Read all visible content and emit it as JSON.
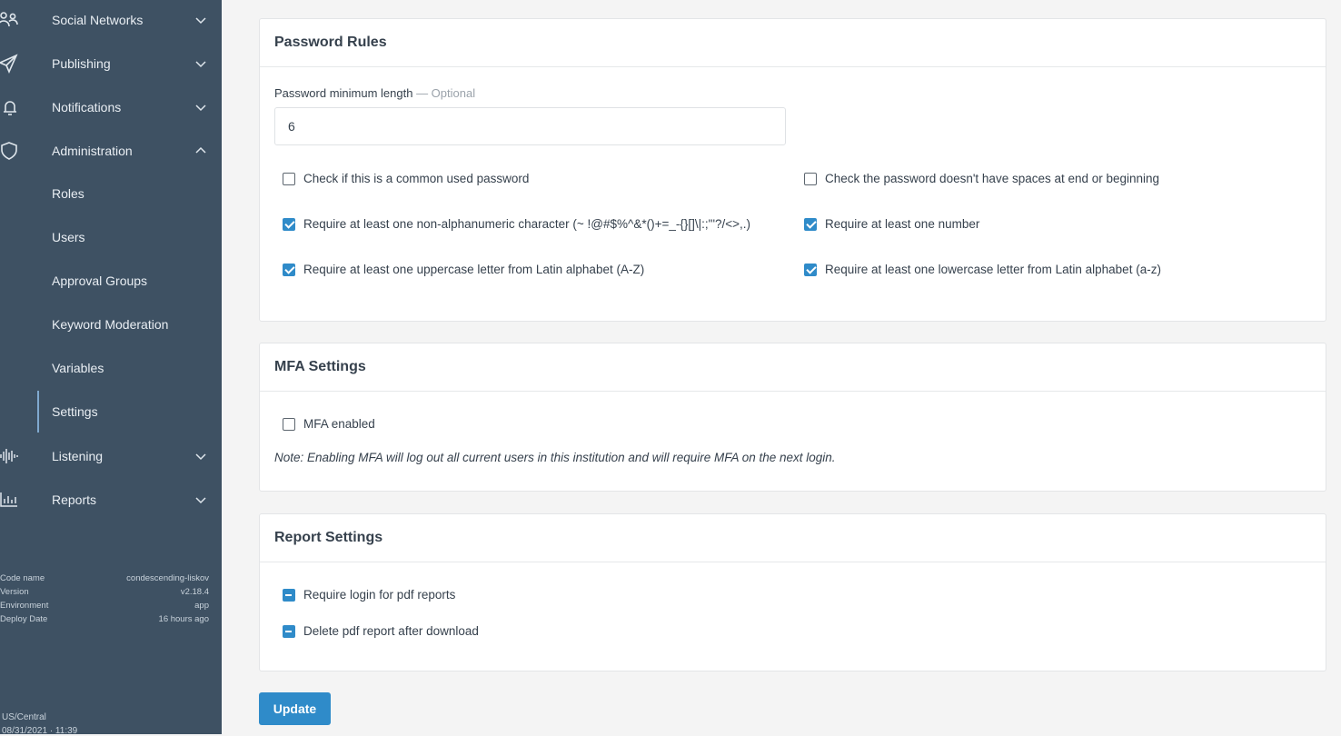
{
  "sidebar": {
    "items": [
      {
        "label": "Social Networks",
        "icon": "users-icon"
      },
      {
        "label": "Publishing",
        "icon": "paper-plane-icon"
      },
      {
        "label": "Notifications",
        "icon": "bell-icon"
      },
      {
        "label": "Administration",
        "icon": "shield-icon"
      },
      {
        "label": "Listening",
        "icon": "waveform-icon"
      },
      {
        "label": "Reports",
        "icon": "bar-chart-icon"
      }
    ],
    "admin_subitems": [
      "Roles",
      "Users",
      "Approval Groups",
      "Keyword Moderation",
      "Variables",
      "Settings"
    ],
    "active_subitem": "Settings",
    "meta": {
      "code_name_label": "Code name",
      "code_name": "condescending-liskov",
      "version_label": "Version",
      "version": "v2.18.4",
      "environment_label": "Environment",
      "environment": "app",
      "deploy_date_label": "Deploy Date",
      "deploy_date": "16 hours ago"
    },
    "timezone": "US/Central",
    "datetime": "08/31/2021 · 11:39"
  },
  "password_rules": {
    "title": "Password Rules",
    "min_length_label": "Password minimum length",
    "min_length_optional": " — Optional",
    "min_length_value": "6",
    "rules": [
      {
        "label": "Check if this is a common used password",
        "checked": false
      },
      {
        "label": "Check the password doesn't have spaces at end or beginning",
        "checked": false
      },
      {
        "label": "Require at least one non-alphanumeric character (~ !@#$%^&*()+=_-{}[]\\|:;\"'?/<>,.)",
        "checked": true
      },
      {
        "label": "Require at least one number",
        "checked": true
      },
      {
        "label": "Require at least one uppercase letter from Latin alphabet (A-Z)",
        "checked": true
      },
      {
        "label": "Require at least one lowercase letter from Latin alphabet (a-z)",
        "checked": true
      }
    ]
  },
  "mfa_settings": {
    "title": "MFA Settings",
    "mfa_label": "MFA enabled",
    "mfa_checked": false,
    "note": "Note: Enabling MFA will log out all current users in this institution and will require MFA on the next login."
  },
  "report_settings": {
    "title": "Report Settings",
    "require_login_label": "Require login for pdf reports",
    "delete_after_label": "Delete pdf report after download"
  },
  "update_label": "Update",
  "colors": {
    "sidebar_bg": "#3e5163",
    "accent": "#2f8bc9",
    "page_bg": "#f4f4f4"
  }
}
